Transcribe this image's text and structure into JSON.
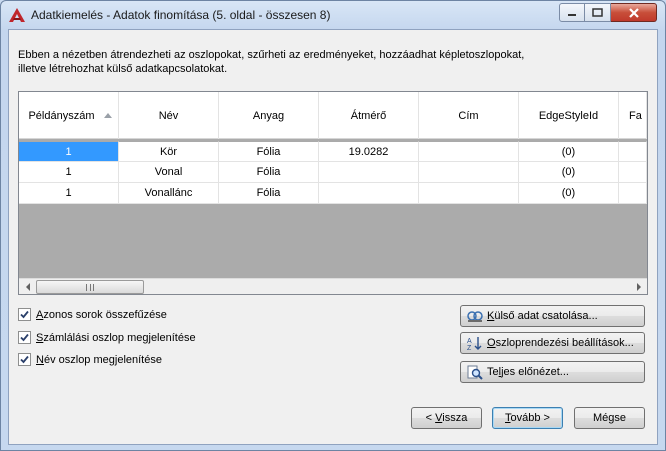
{
  "window": {
    "title": "Adatkiemelés - Adatok finomítása (5. oldal - összesen 8)",
    "icon": "autocad-a-icon"
  },
  "description": {
    "line1": "Ebben a nézetben átrendezheti az oszlopokat, szűrheti az eredményeket, hozzáadhat képletoszlopokat,",
    "line2": "illetve létrehozhat külső adatkapcsolatokat."
  },
  "grid": {
    "columns": [
      "Példányszám",
      "Név",
      "Anyag",
      "Átmérő",
      "Cím",
      "EdgeStyleId",
      "Fa"
    ],
    "rows": [
      [
        "1",
        "Kör",
        "Fólia",
        "19.0282",
        "",
        "(0)",
        ""
      ],
      [
        "1",
        "Vonal",
        "Fólia",
        "",
        "",
        "(0)",
        ""
      ],
      [
        "1",
        "Vonallánc",
        "Fólia",
        "",
        "",
        "(0)",
        ""
      ]
    ]
  },
  "options": {
    "combine": {
      "u": "A",
      "rest": "zonos sorok összefűzése",
      "checked": true
    },
    "count": {
      "u": "S",
      "rest": "zámlálási oszlop megjelenítése",
      "checked": true
    },
    "name": {
      "u": "N",
      "rest": "év oszlop megjelenítése",
      "checked": true
    }
  },
  "side_buttons": {
    "external": {
      "u": "K",
      "rest": "ülső adat csatolása...",
      "icon": "link-data-icon"
    },
    "sort": {
      "u": "O",
      "rest": "szloprendezési beállítások...",
      "icon": "sort-az-icon"
    },
    "preview": {
      "pre": "Te",
      "u": "l",
      "rest": "jes előnézet...",
      "icon": "magnifier-icon"
    }
  },
  "nav_buttons": {
    "back": {
      "pre": "< ",
      "u": "V",
      "rest": "issza"
    },
    "next": {
      "u": "T",
      "rest": "ovább >"
    },
    "cancel": {
      "pre": "",
      "u": "",
      "rest": "Mégse"
    }
  },
  "colors": {
    "accent_selected": "#3399ff",
    "close_button": "#c84f3a"
  }
}
